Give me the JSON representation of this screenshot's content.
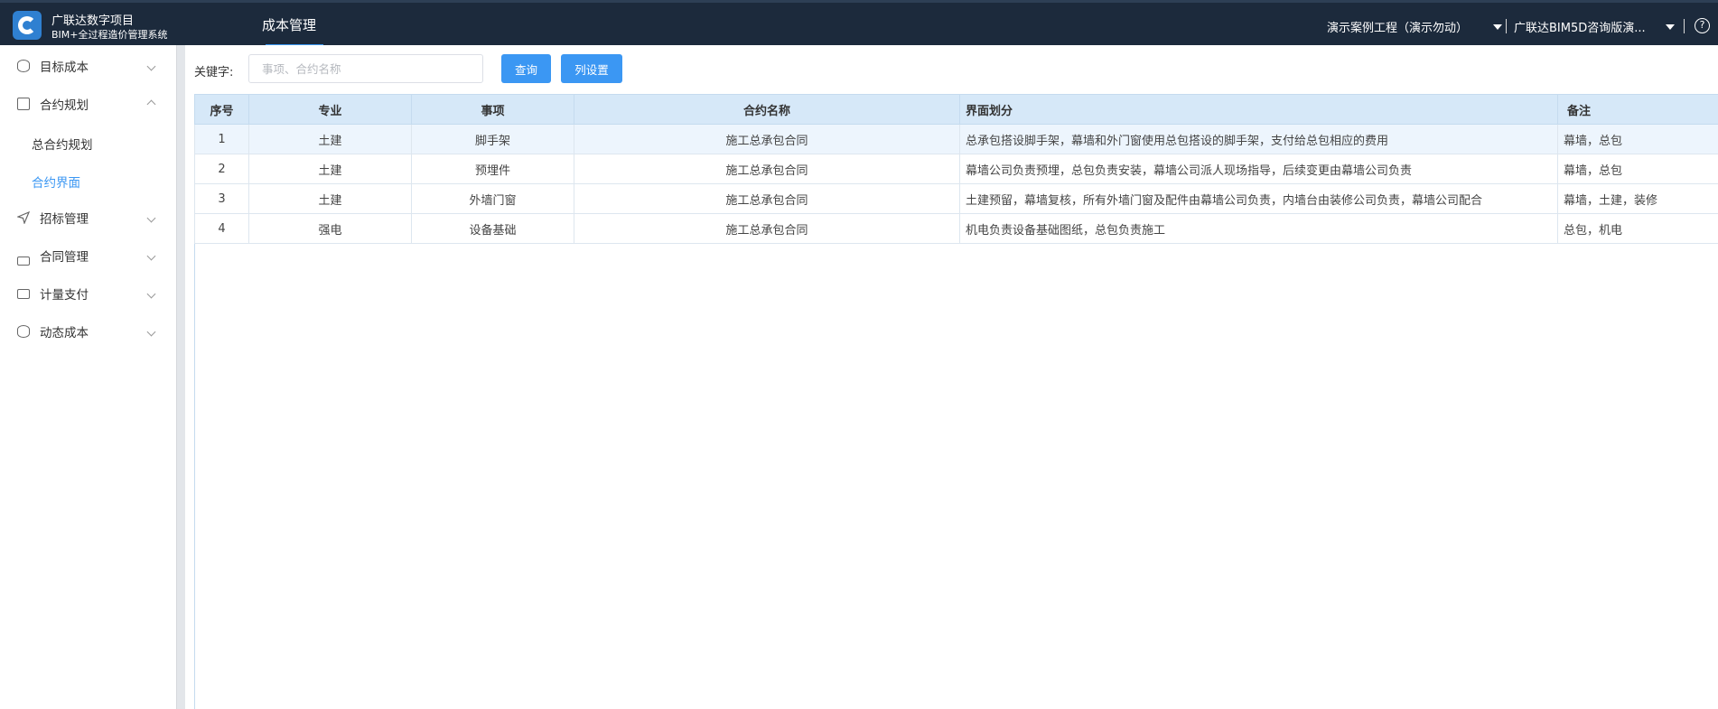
{
  "header": {
    "brand_line1": "广联达数字项目",
    "brand_line2": "BIM+全过程造价管理系统",
    "nav_tab": "成本管理",
    "project": "演示案例工程（演示勿动）",
    "company": "广联达BIM5D咨询版演...",
    "help": "?"
  },
  "sidebar": {
    "items": [
      {
        "label": "目标成本",
        "icon": "database-icon"
      },
      {
        "label": "合约规划",
        "icon": "document-icon"
      },
      {
        "label": "招标管理",
        "icon": "send-icon"
      },
      {
        "label": "合同管理",
        "icon": "stack-icon"
      },
      {
        "label": "计量支付",
        "icon": "briefcase-icon"
      },
      {
        "label": "动态成本",
        "icon": "database-icon"
      }
    ],
    "subitems": [
      {
        "label": "总合约规划"
      },
      {
        "label": "合约界面"
      }
    ]
  },
  "toolbar": {
    "keyword_label": "关键字:",
    "keyword_placeholder": "事项、合约名称",
    "query_button": "查询",
    "columns_button": "列设置"
  },
  "table": {
    "headers": [
      "序号",
      "专业",
      "事项",
      "合约名称",
      "界面划分",
      "备注"
    ],
    "rows": [
      [
        "1",
        "土建",
        "脚手架",
        "施工总承包合同",
        "总承包搭设脚手架，幕墙和外门窗使用总包搭设的脚手架，支付给总包相应的费用",
        "幕墙，总包"
      ],
      [
        "2",
        "土建",
        "预埋件",
        "施工总承包合同",
        "幕墙公司负责预埋，总包负责安装，幕墙公司派人现场指导，后续变更由幕墙公司负责",
        "幕墙，总包"
      ],
      [
        "3",
        "土建",
        "外墙门窗",
        "施工总承包合同",
        "土建预留，幕墙复核，所有外墙门窗及配件由幕墙公司负责，内墙台由装修公司负责，幕墙公司配合",
        "幕墙，土建，装修"
      ],
      [
        "4",
        "强电",
        "设备基础",
        "施工总承包合同",
        "机电负责设备基础图纸，总包负责施工",
        "总包，机电"
      ]
    ]
  },
  "colors": {
    "header_bg": "#1c2a3c",
    "accent": "#3b97f3",
    "table_header_bg": "#d6e8f8"
  }
}
